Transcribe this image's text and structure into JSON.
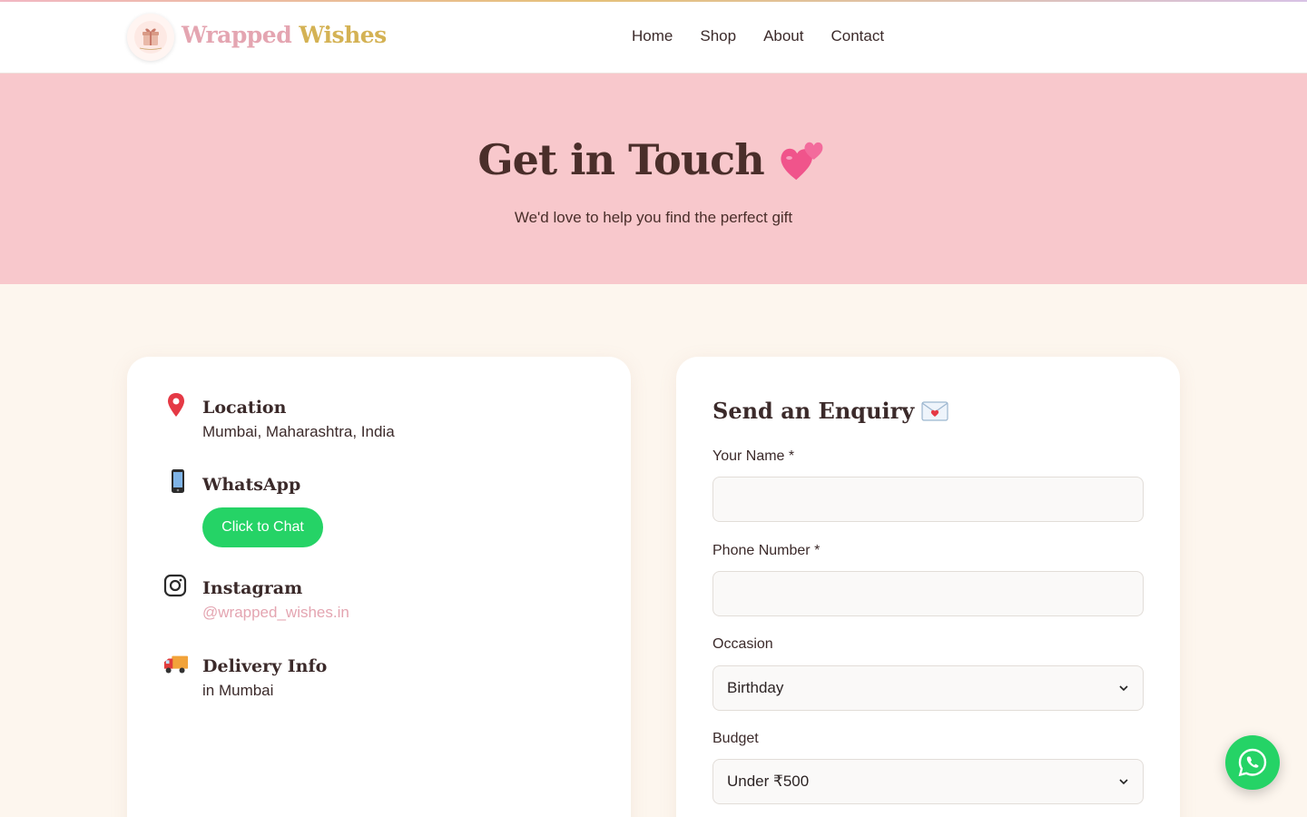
{
  "brand": {
    "part1": "Wrapped",
    "part2": "Wishes",
    "logo_text": "Wrapped Wishes"
  },
  "nav": {
    "items": [
      "Home",
      "Shop",
      "About",
      "Contact"
    ]
  },
  "hero": {
    "title": "Get in Touch",
    "subtitle": "We'd love to help you find the perfect gift"
  },
  "contact": {
    "location": {
      "title": "Location",
      "text": "Mumbai, Maharashtra, India",
      "icon": "pin-icon"
    },
    "whatsapp": {
      "title": "WhatsApp",
      "button": "Click to Chat",
      "icon": "mobile-phone-icon"
    },
    "instagram": {
      "title": "Instagram",
      "handle": "@wrapped_wishes.in",
      "icon": "instagram-icon"
    },
    "delivery": {
      "title": "Delivery Info",
      "text": "in Mumbai",
      "icon": "delivery-truck-icon"
    }
  },
  "form": {
    "title": "Send an Enquiry",
    "name_label": "Your Name *",
    "name_value": "",
    "phone_label": "Phone Number *",
    "phone_value": "",
    "occasion_label": "Occasion",
    "occasion_value": "Birthday",
    "budget_label": "Budget",
    "budget_value": "Under ₹500"
  },
  "colors": {
    "hero_bg": "#f8c8cc",
    "page_bg": "#fdf6ee",
    "brand_pink": "#e4a5b1",
    "brand_gold": "#d4b254",
    "whatsapp_green": "#25d366"
  }
}
